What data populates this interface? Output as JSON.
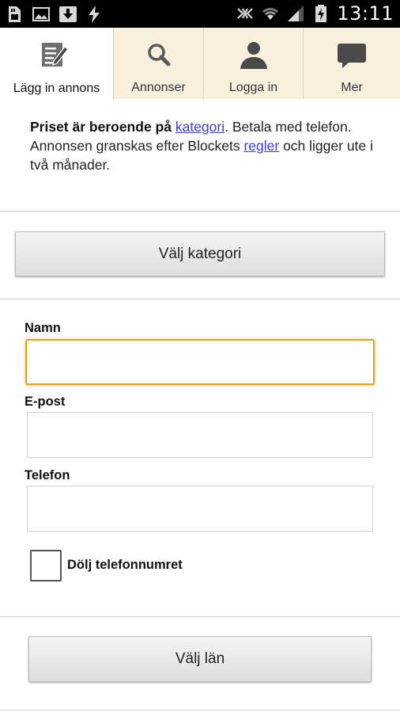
{
  "status_bar": {
    "time": "13:11",
    "left_icons": [
      "sd-card-icon",
      "image-icon",
      "download-icon",
      "sync-icon"
    ],
    "right_icons": [
      "nfc-mute-icon",
      "wifi-icon",
      "signal-icon",
      "battery-charging-icon"
    ]
  },
  "tabs": [
    {
      "label": "Lägg in annons",
      "icon": "edit-document-icon",
      "active": true
    },
    {
      "label": "Annonser",
      "icon": "search-icon",
      "active": false
    },
    {
      "label": "Logga in",
      "icon": "user-icon",
      "active": false
    },
    {
      "label": "Mer",
      "icon": "chat-bubble-icon",
      "active": false
    }
  ],
  "intro": {
    "bold": "Priset är beroende på",
    "link1": "kategori",
    "text1": ". Betala med telefon. Annonsen granskas efter Blockets",
    "link2": "regler",
    "text2": "och ligger ute i två månader."
  },
  "category_button": "Välj kategori",
  "form": {
    "name_label": "Namn",
    "name_value": "",
    "email_label": "E-post",
    "email_value": "",
    "phone_label": "Telefon",
    "phone_value": "",
    "hide_phone_label": "Dölj telefonnumret",
    "hide_phone_checked": false
  },
  "county_button": "Välj län",
  "colors": {
    "accent_focus": "#f09a1a",
    "tab_bg": "#f7f0dc",
    "link": "#3a3fd0"
  }
}
